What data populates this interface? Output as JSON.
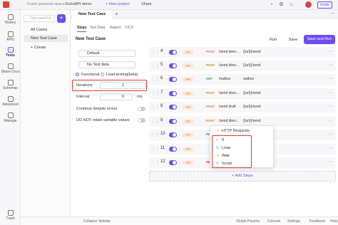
{
  "topbar": {
    "workspace": "Frank personal space",
    "project": "EchoAPI demo",
    "new_project": "+ New project",
    "share": "Share",
    "invite": "Invite"
  },
  "rail": {
    "items": [
      {
        "label": "History",
        "icon": "clock-icon"
      },
      {
        "label": "APIs",
        "icon": "api-icon"
      },
      {
        "label": "Tests",
        "icon": "test-icon"
      },
      {
        "label": "Share Docs",
        "icon": "docs-icon"
      },
      {
        "label": "Schemas",
        "icon": "schema-icon"
      },
      {
        "label": "Advanced",
        "icon": "advanced-icon"
      },
      {
        "label": "Manage",
        "icon": "manage-icon"
      },
      {
        "label": "Trash",
        "icon": "trash-icon"
      }
    ]
  },
  "tree": {
    "search_placeholder": "Test case/Fol...",
    "all_cases": "All Cases",
    "new_case": "New Test Case",
    "create": "+ Create"
  },
  "tab": {
    "label": "New Test Case",
    "title": "New Test Case"
  },
  "subtabs": [
    "Steps",
    "Test Data",
    "Report",
    "CICD"
  ],
  "actions": {
    "run": "Run",
    "save": "Save",
    "save_run": "Save and Run"
  },
  "form": {
    "env": "Default",
    "data": "No Test data",
    "functional": "Functional",
    "load": "Load testing(beta)",
    "iterations_label": "Iterations",
    "iterations_value": "1",
    "interval_label": "Interval",
    "interval_value": "0",
    "interval_unit": "ms",
    "continue_label": "Continue despite errors",
    "retain_label": "DO NOT retain variable values"
  },
  "steps": [
    {
      "num": "4",
      "api": "API",
      "method": "POST",
      "color": "#e07a24",
      "url": "/send direc...",
      "name": "{{url}}/send"
    },
    {
      "num": "5",
      "api": "API",
      "method": "POST",
      "color": "#e07a24",
      "url": "/send direc...",
      "name": "{{url}}/send"
    },
    {
      "num": "6",
      "api": "API",
      "method": "GET",
      "color": "#2e9e5b",
      "url": "/outbox",
      "name": "outbox"
    },
    {
      "num": "7",
      "api": "API",
      "method": "POST",
      "color": "#e07a24",
      "url": "/send direc...",
      "name": "{{url}}/send"
    },
    {
      "num": "8",
      "api": "API",
      "method": "POST",
      "color": "#e07a24",
      "url": "/send draft",
      "name": "{{url}}/send"
    },
    {
      "num": "9",
      "api": "API",
      "method": "POST",
      "color": "#e07a24",
      "url": "/send direc...",
      "name": "{{url}}/send"
    },
    {
      "num": "10",
      "api": "API",
      "method": "PU",
      "color": "#2f6fd6",
      "url": "",
      "name": "_id}"
    },
    {
      "num": "11",
      "api": "API",
      "method": "",
      "color": "#e07a24",
      "url": "",
      "name": ""
    },
    {
      "num": "12",
      "api": "API",
      "method": "DE",
      "color": "#d9363e",
      "url": "",
      "name": "ssages_id}}"
    }
  ],
  "add_steps": "+ Add Steps",
  "popup": {
    "items": [
      {
        "label": "HTTP Requests",
        "icon": "http-icon"
      },
      {
        "label": "If",
        "icon": "if-icon"
      },
      {
        "label": "Loop",
        "icon": "loop-icon"
      },
      {
        "label": "Wait",
        "icon": "wait-icon"
      },
      {
        "label": "Script",
        "icon": "script-icon"
      }
    ]
  },
  "bottombar": {
    "collapse": "Collapse Sidebar",
    "global": "Global Params",
    "console": "Console",
    "settings": "Settings",
    "feedback": "Feedback",
    "help": "Help"
  },
  "colors": {
    "accent": "#6c4cf0",
    "highlight": "#e23a2e"
  }
}
